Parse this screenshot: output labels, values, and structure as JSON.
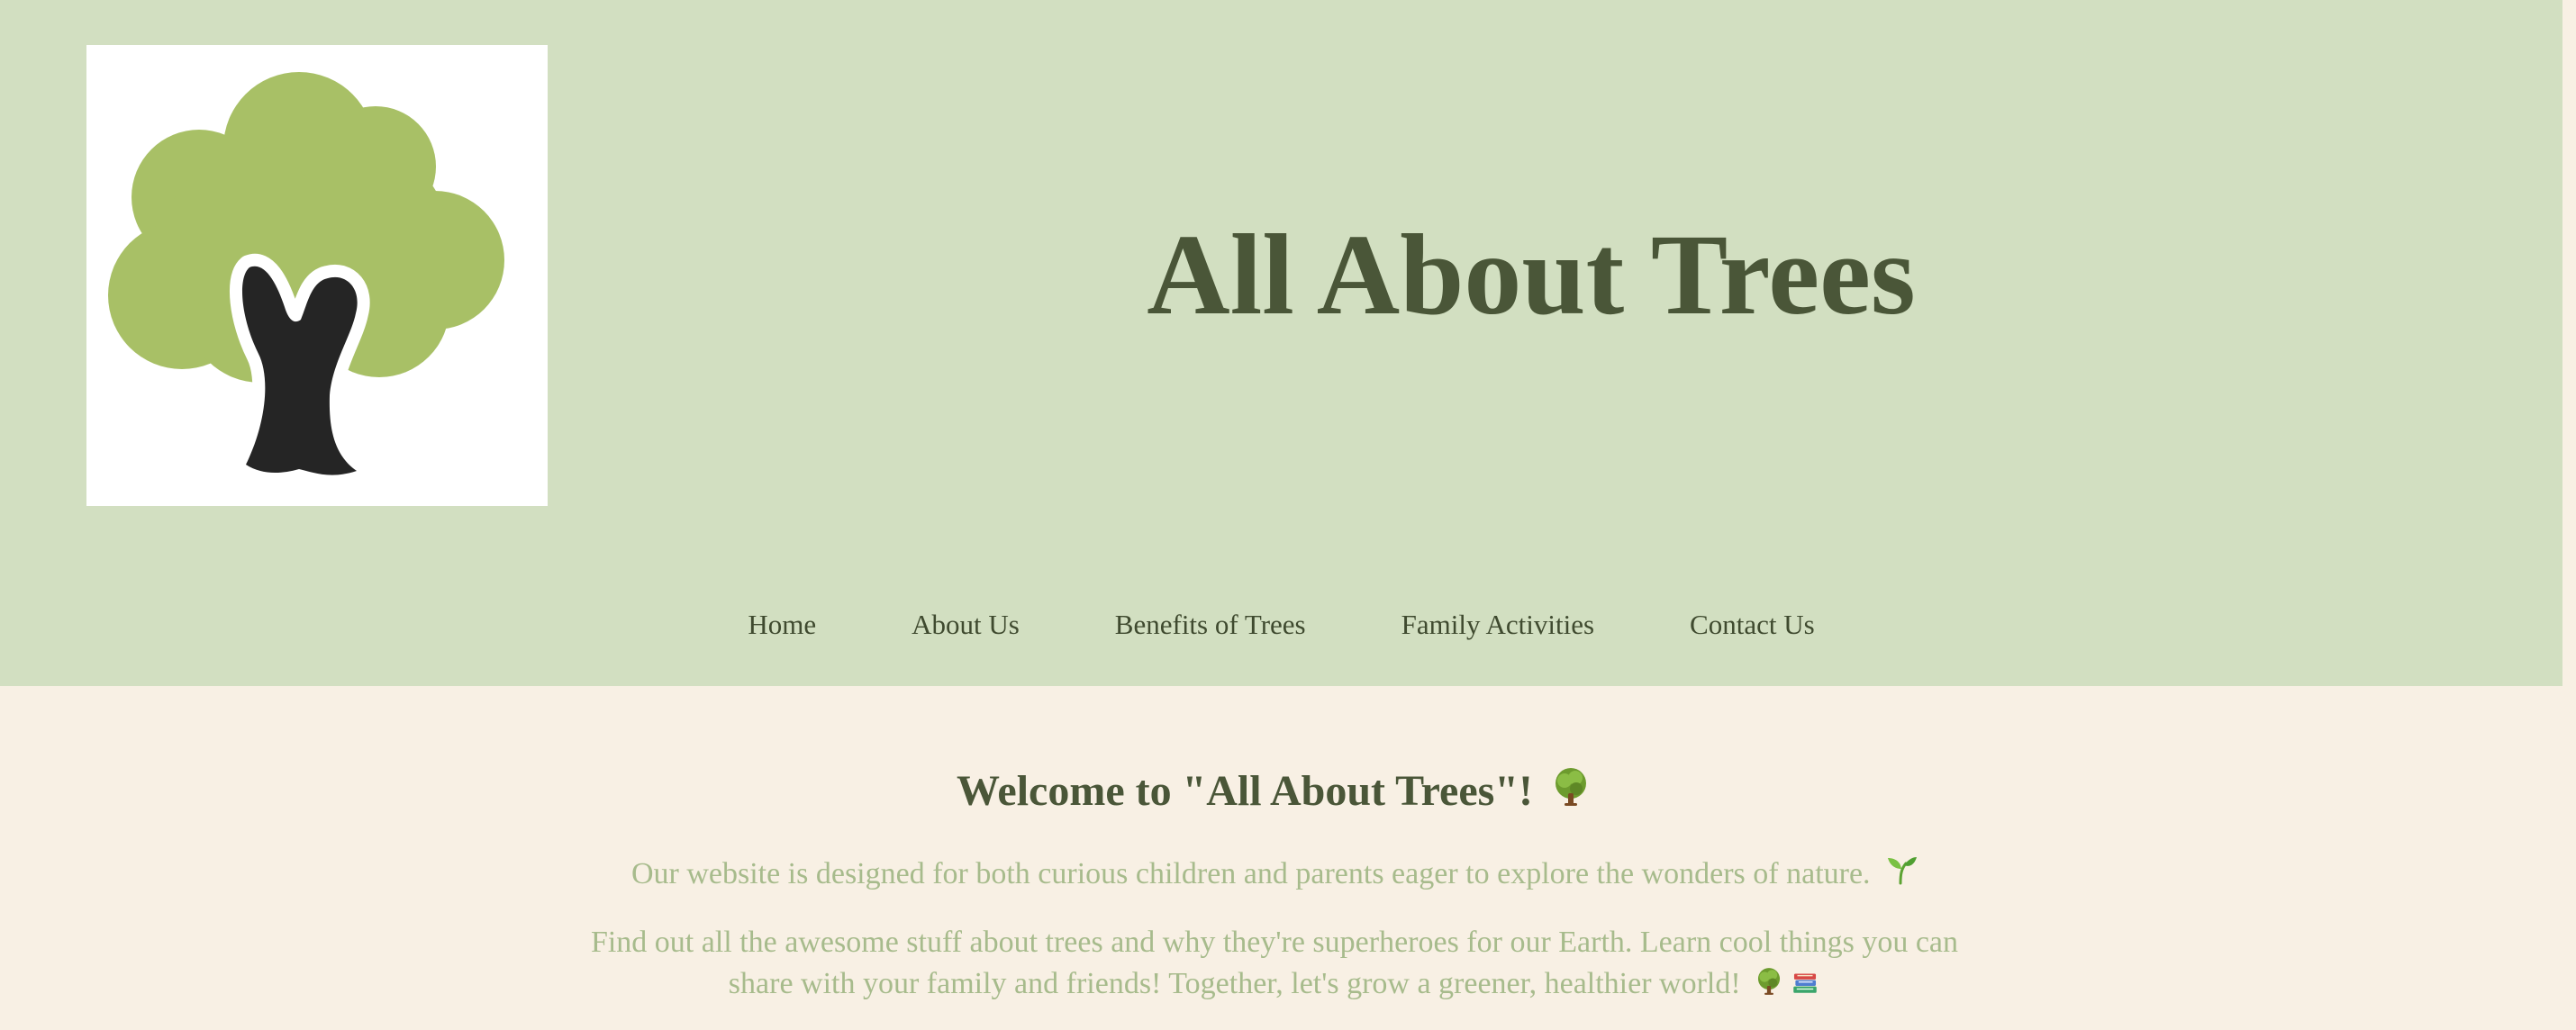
{
  "header": {
    "logo_alt": "tree-logo",
    "title": "All About Trees"
  },
  "nav": {
    "items": [
      {
        "label": "Home"
      },
      {
        "label": "About Us"
      },
      {
        "label": "Benefits of Trees"
      },
      {
        "label": "Family Activities"
      },
      {
        "label": "Contact Us"
      }
    ]
  },
  "main": {
    "welcome": "Welcome to \"All About Trees\"!",
    "intro": "Our website is designed for both curious children and parents eager to explore the wonders of nature.",
    "details": "Find out all the awesome stuff about trees and why they're superheroes for our Earth. Learn cool things you can share with your family and friends! Together, let's grow a greener, healthier world!"
  },
  "icons": {
    "welcome": "tree-emoji-icon",
    "intro": "seedling-emoji-icon",
    "details_1": "tree-emoji-icon",
    "details_2": "books-emoji-icon"
  },
  "colors": {
    "header_bg": "#d2dfc1",
    "page_bg": "#f8f0e4",
    "title": "#4a5638",
    "nav_text": "#3f4a2f",
    "body_text": "#a7bb8c",
    "tree_canopy": "#a8c066",
    "tree_trunk": "#252525"
  }
}
